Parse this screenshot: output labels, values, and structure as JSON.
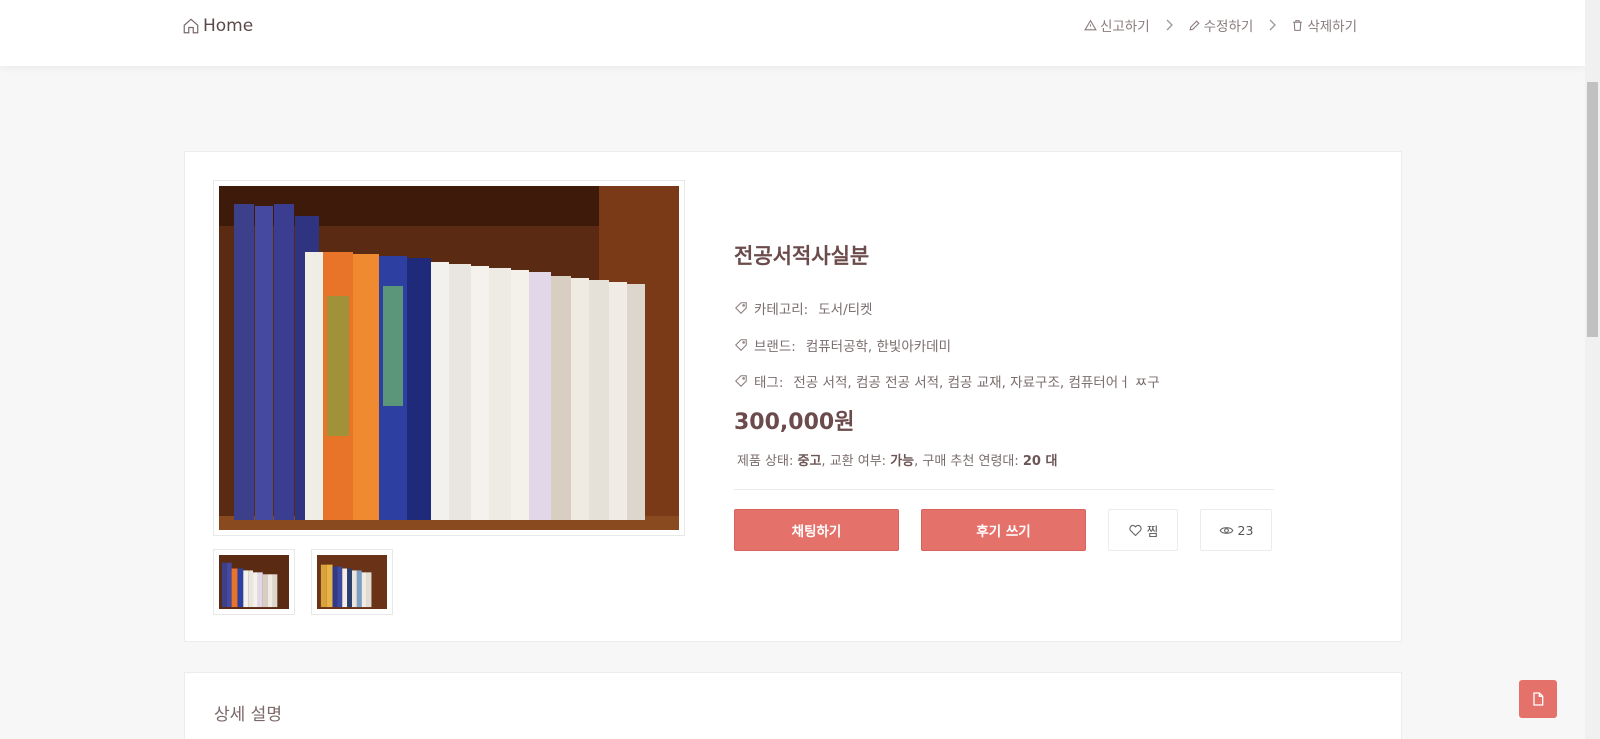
{
  "header": {
    "home_label": "Home",
    "actions": [
      {
        "label": "신고하기",
        "icon": "alert-triangle-icon"
      },
      {
        "label": "수정하기",
        "icon": "pencil-icon"
      },
      {
        "label": "삭제하기",
        "icon": "trash-icon"
      }
    ]
  },
  "product": {
    "title": "전공서적사실분",
    "category_label": "카테고리:",
    "category_value": "도서/티켓",
    "brand_label": "브랜드:",
    "brand_value": "컴퓨터공학, 한빛아카데미",
    "tags_label": "태그:",
    "tags_value": "전공 서적, 컴공 전공 서적, 컴공 교재, 자료구조, 컴퓨터어ㅓ ㅉ구",
    "price": "300,000원",
    "status": {
      "condition_label": "제품 상태:",
      "condition_value": "중고",
      "exchange_label": "교환 여부:",
      "exchange_value": "가능",
      "age_label": "구매 추천 연령대:",
      "age_value": "20 대"
    }
  },
  "buttons": {
    "chat": "채팅하기",
    "review": "후기 쓰기",
    "like": "찜",
    "views": "23"
  },
  "description": {
    "title": "상세 설명"
  },
  "colors": {
    "accent": "#e5716b",
    "title_text": "#6b4b4b"
  }
}
